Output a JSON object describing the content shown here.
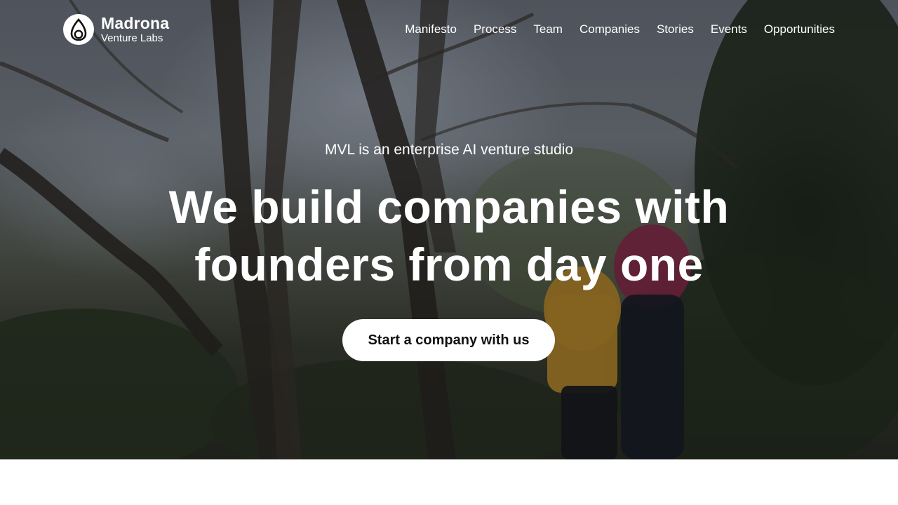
{
  "header": {
    "logo": {
      "name": "Madrona",
      "subname": "Venture Labs",
      "icon": "madrona-drop-icon"
    },
    "nav": [
      {
        "label": "Manifesto"
      },
      {
        "label": "Process"
      },
      {
        "label": "Team"
      },
      {
        "label": "Companies"
      },
      {
        "label": "Stories"
      },
      {
        "label": "Events"
      },
      {
        "label": "Opportunities"
      }
    ]
  },
  "hero": {
    "kicker": "MVL is an enterprise AI venture studio",
    "headline_line1": "We build companies with",
    "headline_line2": "founders from day one",
    "cta_label": "Start a company with us",
    "background": "forest-walk-photo"
  },
  "colors": {
    "text_on_hero": "#ffffff",
    "cta_background": "#ffffff",
    "cta_text": "#111111",
    "page_background": "#ffffff"
  }
}
